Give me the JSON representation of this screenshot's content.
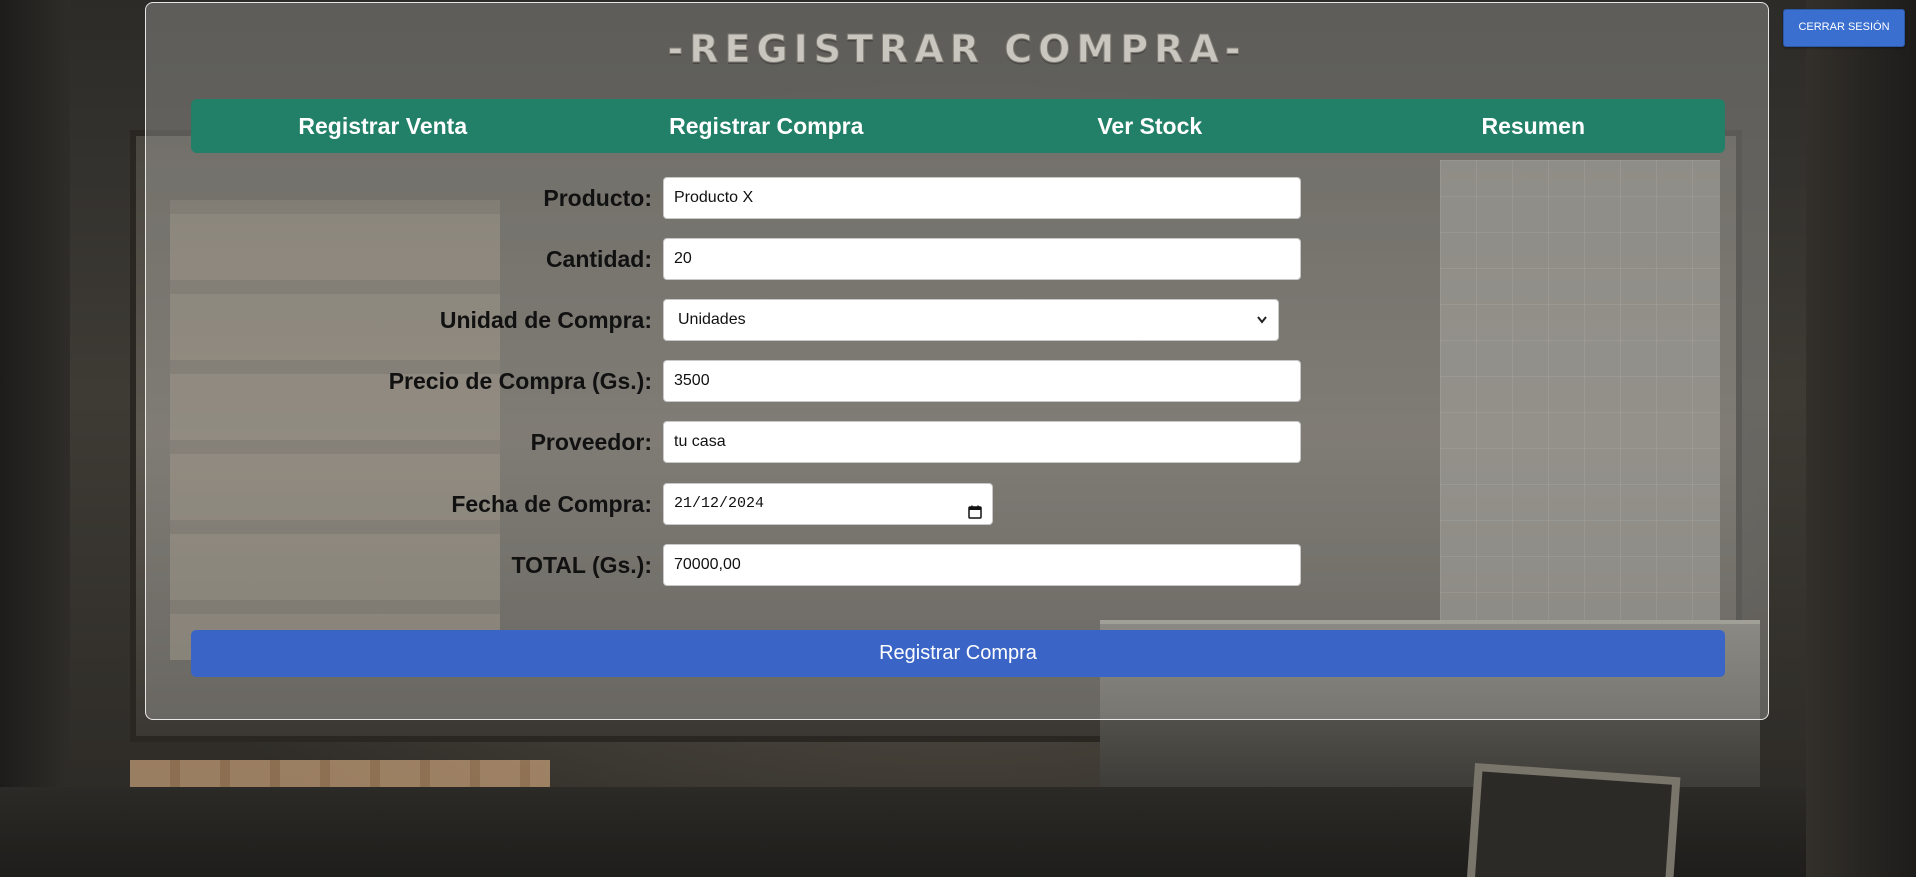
{
  "header": {
    "title": "-REGISTRAR COMPRA-",
    "logout_label": "CERRAR SESIÓN"
  },
  "nav": {
    "items": [
      "Registrar Venta",
      "Registrar Compra",
      "Ver Stock",
      "Resumen"
    ]
  },
  "form": {
    "producto": {
      "label": "Producto:",
      "value": "Producto X"
    },
    "cantidad": {
      "label": "Cantidad:",
      "value": "20"
    },
    "unidad": {
      "label": "Unidad de Compra:",
      "selected": "Unidades"
    },
    "precio": {
      "label": "Precio de Compra (Gs.):",
      "value": "3500"
    },
    "proveedor": {
      "label": "Proveedor:",
      "value": "tu casa"
    },
    "fecha": {
      "label": "Fecha de Compra:",
      "value": "21/12/2024"
    },
    "total": {
      "label": "TOTAL (Gs.):",
      "value": "70000,00"
    },
    "submit_label": "Registrar Compra"
  },
  "colors": {
    "nav_bg": "#218067",
    "submit_bg": "#3a65c6",
    "logout_bg": "#3a6fd0"
  },
  "icons": {
    "select_caret": "chevron-down-icon",
    "date_picker": "calendar-icon"
  }
}
